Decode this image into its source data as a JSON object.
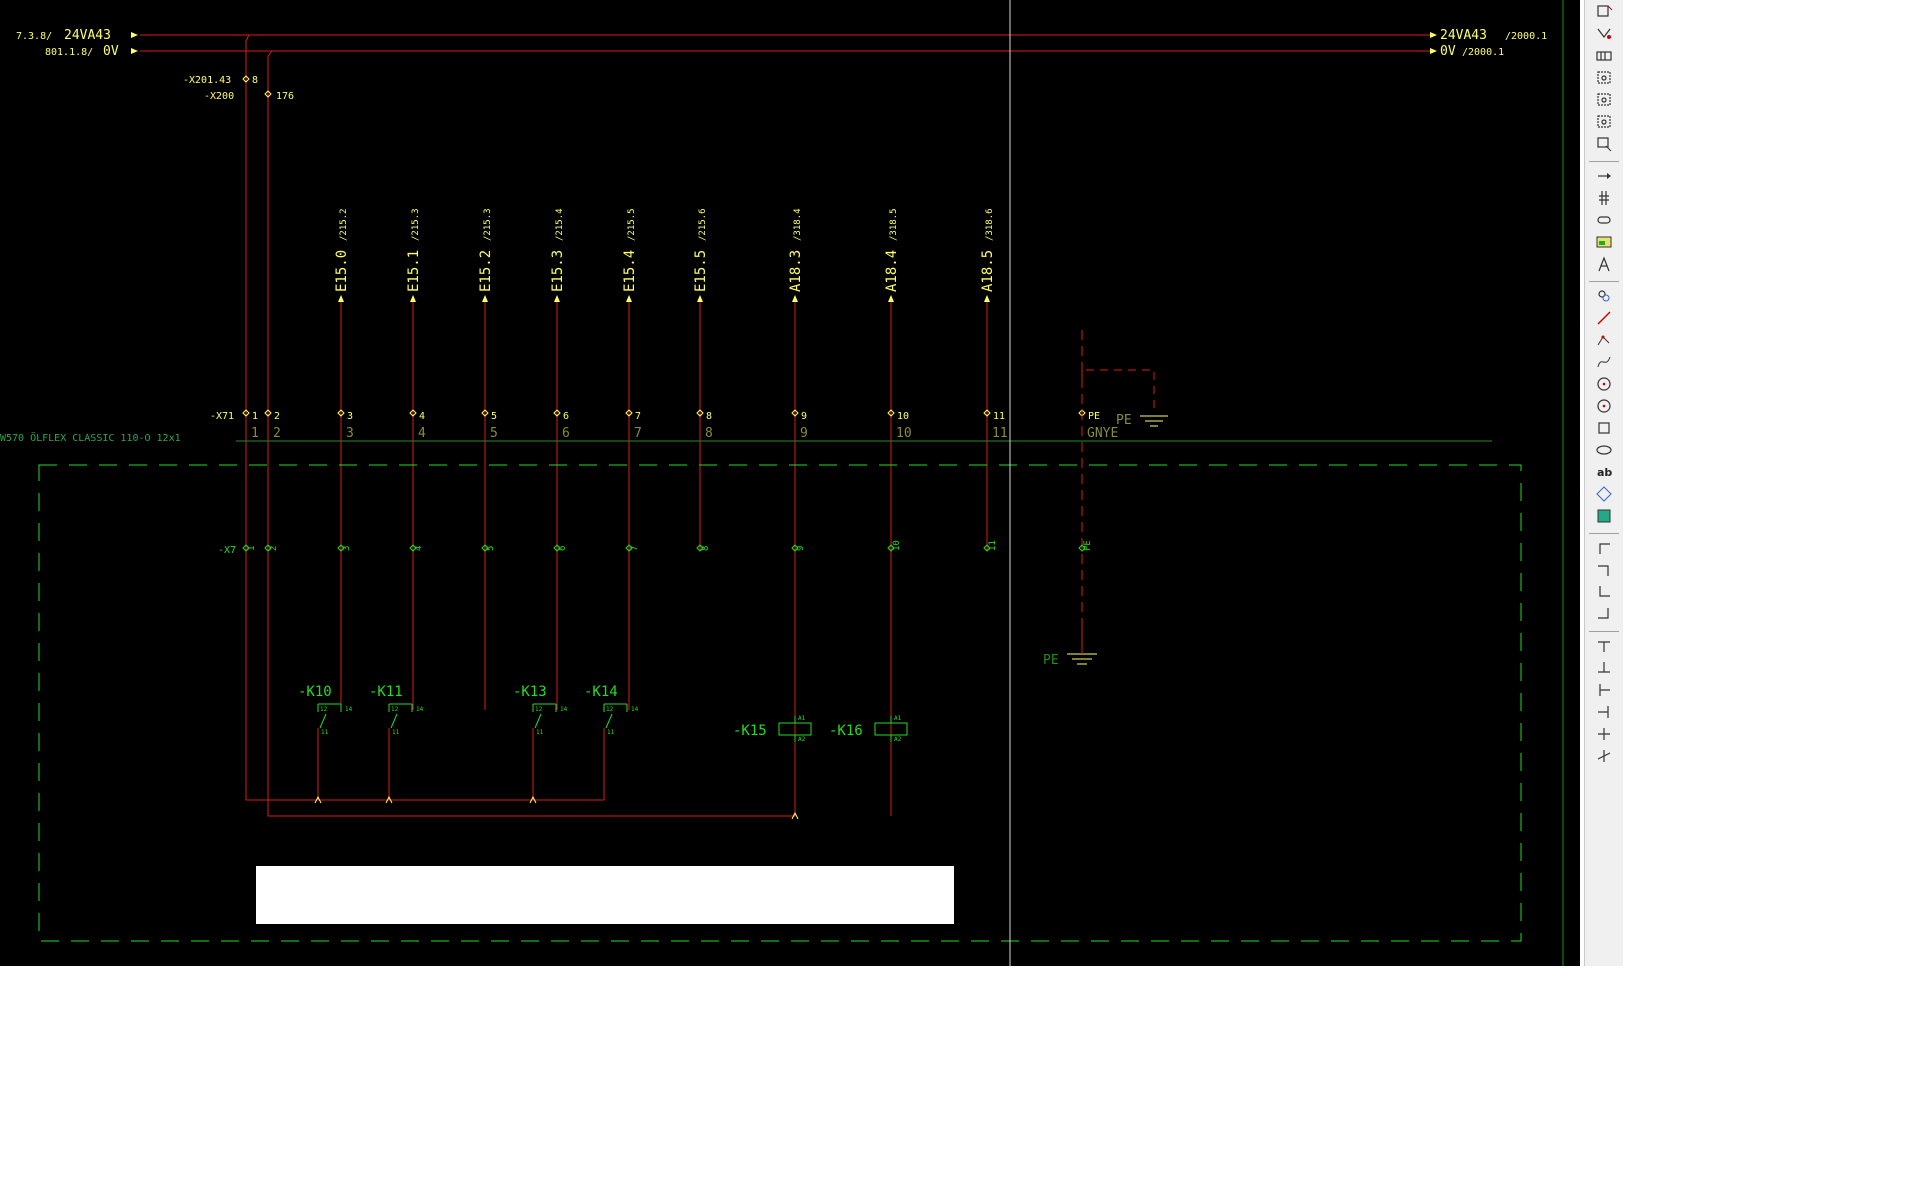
{
  "colors": {
    "wire": "#d81c1c",
    "yellow": "#ffff66",
    "green": "#22dd22",
    "dim_green": "#1f8f1f",
    "cable_text": "#2aa84a",
    "bg": "#000000",
    "cursor_line": "#d8d8d8"
  },
  "potentials": {
    "left_ref_1": "7.3.8/",
    "left_label_1": "24VA43",
    "left_ref_2": "801.1.8/",
    "left_label_2": "0V",
    "right_label_1": "24VA43",
    "right_ref_1": "/2000.1",
    "right_label_2": "0V",
    "right_ref_2": "/2000.1"
  },
  "terminals_top": {
    "x201": "-X201.43",
    "x201_num": "8",
    "x200": "-X200",
    "x200_num": "176"
  },
  "plc_signals": [
    {
      "label": "E15.0",
      "ref": "/215.2"
    },
    {
      "label": "E15.1",
      "ref": "/215.3"
    },
    {
      "label": "E15.2",
      "ref": "/215.3"
    },
    {
      "label": "E15.3",
      "ref": "/215.4"
    },
    {
      "label": "E15.4",
      "ref": "/215.5"
    },
    {
      "label": "E15.5",
      "ref": "/215.6"
    },
    {
      "label": "A18.3",
      "ref": "/318.4"
    },
    {
      "label": "A18.4",
      "ref": "/318.5"
    },
    {
      "label": "A18.5",
      "ref": "/318.6"
    }
  ],
  "terminal_strip_upper": {
    "name": "-X71",
    "terminals": [
      "1",
      "2",
      "3",
      "4",
      "5",
      "6",
      "7",
      "8",
      "9",
      "10",
      "11",
      "PE"
    ]
  },
  "cable": {
    "name": "W570 ÖLFLEX CLASSIC 110-O 12x1",
    "cores": [
      "1",
      "2",
      "3",
      "4",
      "5",
      "6",
      "7",
      "8",
      "9",
      "10",
      "11",
      "GNYE"
    ],
    "pe_label": "PE"
  },
  "terminal_strip_lower": {
    "name": "-X7",
    "terminals": [
      "1",
      "2",
      "3",
      "4",
      "5",
      "6",
      "7",
      "8",
      "9",
      "10",
      "11",
      "PE"
    ]
  },
  "ground_label": "PE",
  "relays": [
    {
      "name": "-K10",
      "c1": "12",
      "c2": "14",
      "c3": "11"
    },
    {
      "name": "-K11",
      "c1": "12",
      "c2": "14",
      "c3": "11"
    },
    {
      "name": "-K13",
      "c1": "12",
      "c2": "14",
      "c3": "11"
    },
    {
      "name": "-K14",
      "c1": "12",
      "c2": "14",
      "c3": "11"
    }
  ],
  "coils": [
    {
      "name": "-K15",
      "a1": "A1",
      "a2": "A2"
    },
    {
      "name": "-K16",
      "a1": "A1",
      "a2": "A2"
    }
  ],
  "toolbar": {
    "buttons": [
      "insert-device-icon",
      "insert-macro-icon",
      "insert-terminal-strip-icon",
      "insert-black-box-icon",
      "insert-device-box-icon",
      "insert-structure-box-icon",
      "insert-plc-box-icon",
      "insert-interruption-point-icon",
      "insert-bus-icon",
      "insert-cable-definition-icon",
      "insert-path-function-icon",
      "insert-text-icon",
      "insert-link-icon",
      "draw-line-icon",
      "draw-polyline-icon",
      "draw-spline-icon",
      "draw-circle-icon",
      "draw-arc-icon",
      "draw-rectangle-icon",
      "draw-ellipse-icon",
      "insert-property-text-icon",
      "insert-placeholder-icon",
      "insert-image-icon",
      "angle-down-right-icon",
      "angle-down-left-icon",
      "angle-up-right-icon",
      "angle-up-left-icon",
      "t-node-down-icon",
      "t-node-up-icon",
      "t-node-right-icon",
      "t-node-left-icon",
      "cross-jump-icon",
      "cross-connect-icon"
    ]
  }
}
